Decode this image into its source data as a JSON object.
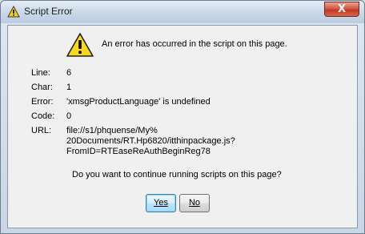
{
  "window": {
    "title": "Script Error",
    "close_label": "X"
  },
  "dialog": {
    "headline": "An error has occurred in the script on this page.",
    "fields": [
      {
        "label": "Line:",
        "value": "6"
      },
      {
        "label": "Char:",
        "value": "1"
      },
      {
        "label": "Error:",
        "value": "'xmsgProductLanguage' is undefined"
      },
      {
        "label": "Code:",
        "value": "0"
      },
      {
        "label": "URL:",
        "value": "file://s1/phquense/My%\n20Documents/RT.Hp6820/itthinpackage.js?\nFromID=RTEaseReAuthBeginReg78"
      }
    ],
    "prompt": "Do you want to continue running scripts on this page?",
    "yes_label": "Yes",
    "no_label": "No"
  }
}
